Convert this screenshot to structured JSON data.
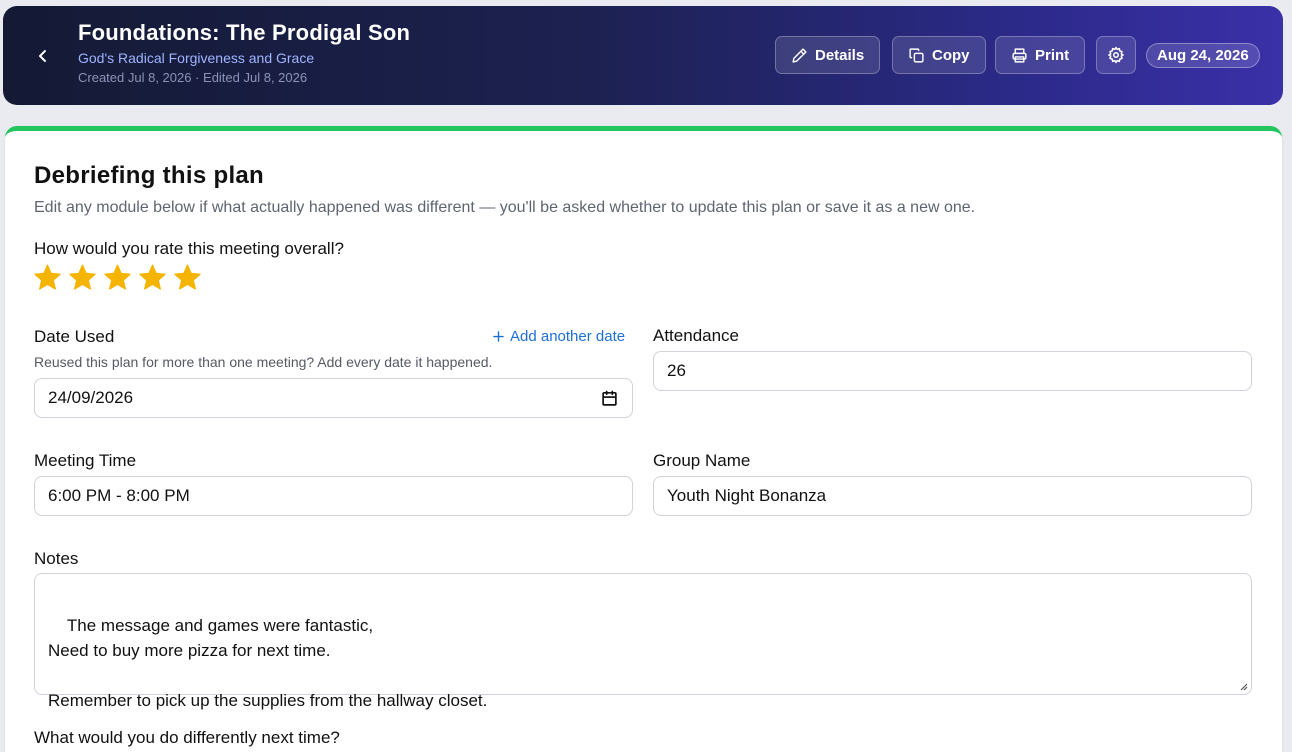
{
  "header": {
    "title": "Foundations: The Prodigal Son",
    "subtitle": "God's Radical Forgiveness and Grace",
    "meta": "Created Jul 8, 2026 · Edited Jul 8, 2026",
    "buttons": {
      "details": "Details",
      "copy": "Copy",
      "print": "Print"
    },
    "date_pill": "Aug 24, 2026"
  },
  "card": {
    "title": "Debriefing this plan",
    "description": "Edit any module below if what actually happened was different — you'll be asked whether to update this plan or save it as a new one.",
    "rating": {
      "label": "How would you rate this meeting overall?",
      "value": 5,
      "max": 5,
      "color": "#f5b400"
    },
    "date_used": {
      "label": "Date Used",
      "add_link": "Add another date",
      "hint": "Reused this plan for more than one meeting? Add every date it happened.",
      "value": "24/09/2026"
    },
    "attendance": {
      "label": "Attendance",
      "value": "26"
    },
    "meeting_time": {
      "label": "Meeting Time",
      "value": "6:00 PM - 8:00 PM"
    },
    "group_name": {
      "label": "Group Name",
      "value": "Youth Night Bonanza"
    },
    "notes": {
      "label": "Notes",
      "value": "The message and games were fantastic,\nNeed to buy more pizza for next time.\n\nRemember to pick up the supplies from the hallway closet."
    },
    "next_question": {
      "label": "What would you do differently next time?"
    }
  },
  "colors": {
    "accent_green": "#22c55e",
    "link_blue": "#1d6fd8"
  }
}
